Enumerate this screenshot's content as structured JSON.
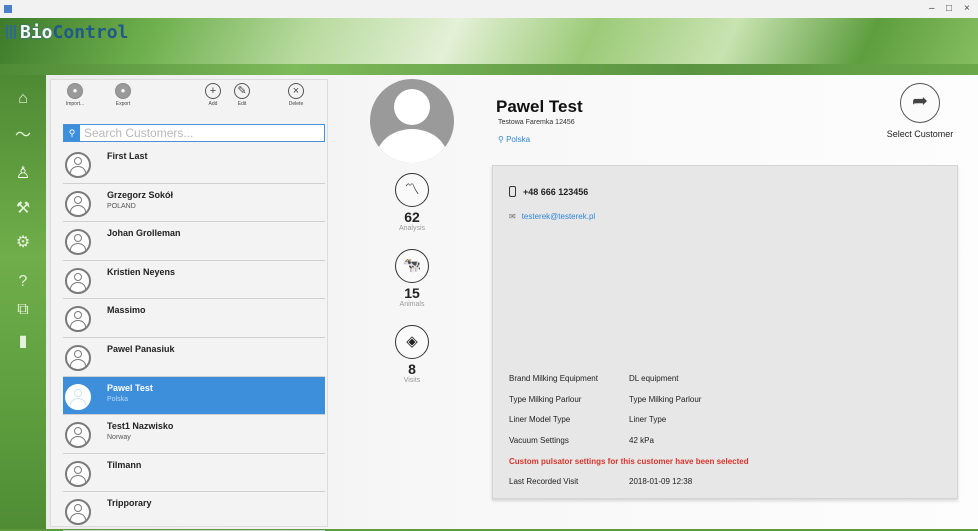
{
  "window": {
    "title": "",
    "controls": {
      "minimize": "–",
      "maximize": "□",
      "close": "×"
    }
  },
  "header": {
    "logo_part1": "Bio",
    "logo_part2": "Control",
    "tagline": ""
  },
  "breadcrumb": "",
  "nav": [
    {
      "icon": "home-icon",
      "glyph": "⌂"
    },
    {
      "icon": "analysis-chart-icon",
      "glyph": "〜"
    },
    {
      "icon": "customers-icon",
      "glyph": "♙",
      "selected": true
    },
    {
      "icon": "tools-icon",
      "glyph": "⚒"
    },
    {
      "icon": "settings-icon",
      "glyph": "⚙"
    },
    {
      "icon": "help-icon",
      "glyph": "?"
    },
    {
      "icon": "devices-icon",
      "glyph": "⧉"
    },
    {
      "icon": "exit-door-icon",
      "glyph": "▮"
    }
  ],
  "toolbar": {
    "import_label": "Import...",
    "export_label": "Export",
    "add_label": "Add",
    "edit_label": "Edit",
    "delete_label": "Delete"
  },
  "search": {
    "placeholder": "Search Customers..."
  },
  "customers": [
    {
      "name": "First Last",
      "subtitle": ""
    },
    {
      "name": "Grzegorz Sokół",
      "subtitle": "POLAND"
    },
    {
      "name": "Johan Grolleman",
      "subtitle": ""
    },
    {
      "name": "Kristien Neyens",
      "subtitle": ""
    },
    {
      "name": "Massimo",
      "subtitle": ""
    },
    {
      "name": "Pawel Panasiuk",
      "subtitle": ""
    },
    {
      "name": "Pawel Test",
      "subtitle": "Polska",
      "selected": true
    },
    {
      "name": "Test1 Nazwisko",
      "subtitle": "Norway"
    },
    {
      "name": "Tilmann",
      "subtitle": ""
    },
    {
      "name": "Tripporary",
      "subtitle": ""
    }
  ],
  "stats": {
    "analysis": {
      "value": "62",
      "label": "Analysis"
    },
    "animals": {
      "value": "15",
      "label": "Animals"
    },
    "visits": {
      "value": "8",
      "label": "Visits"
    }
  },
  "detail": {
    "name": "Pawel Test",
    "farm": "Testowa Faremka  12456",
    "country": "Polska",
    "phone": "+48 666 123456",
    "email": "testerek@testerek.pl",
    "select_label": "Select Customer",
    "properties": [
      {
        "key": "Brand Milking Equipment",
        "value": "DL equipment"
      },
      {
        "key": "Type Milking Parlour",
        "value": "Type Milking Parlour"
      },
      {
        "key": "Liner Model Type",
        "value": "Liner Type"
      },
      {
        "key": "Vacuum Settings",
        "value": "42  kPa"
      }
    ],
    "warning": "Custom pulsator settings for this customer have been selected",
    "last_visit_key": "Last Recorded Visit",
    "last_visit_value": "2018-01-09 12:38"
  }
}
